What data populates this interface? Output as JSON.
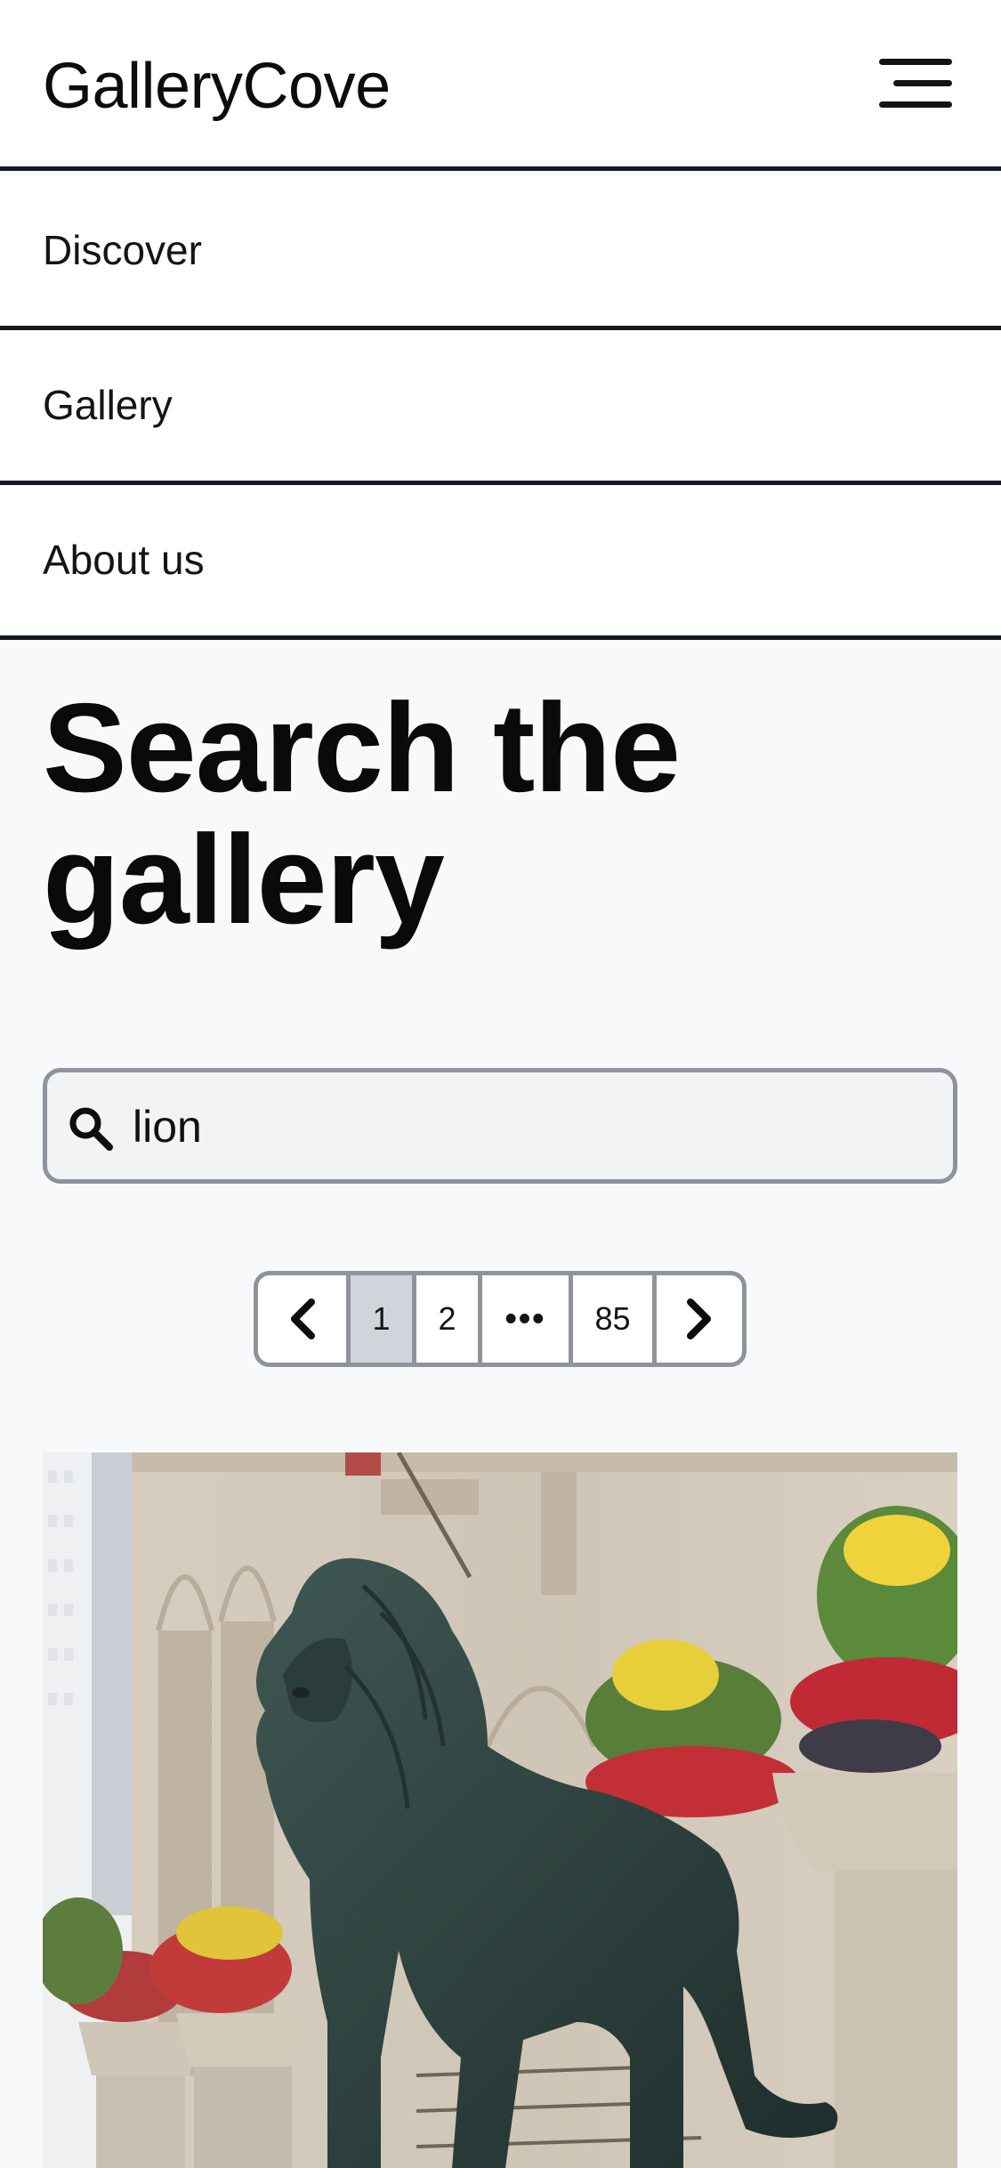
{
  "header": {
    "brand": "GalleryCove",
    "menu_icon": "hamburger-menu-icon"
  },
  "nav": {
    "items": [
      {
        "label": "Discover"
      },
      {
        "label": "Gallery"
      },
      {
        "label": "About us"
      }
    ]
  },
  "main": {
    "title": "Search the gallery",
    "search": {
      "value": "lion",
      "icon": "search-icon"
    },
    "pagination": {
      "prev_icon": "chevron-left-icon",
      "pages": [
        "1",
        "2",
        "•••",
        "85"
      ],
      "current": "1",
      "next_icon": "chevron-right-icon"
    },
    "results": [
      {
        "image": "bronze lion statue in front of museum building with flower planters"
      }
    ]
  },
  "colors": {
    "background": "#f8f9fb",
    "header_bg": "#ffffff",
    "divider": "#141a22",
    "input_border": "#8e939c",
    "current_page_bg": "#d0d4db"
  }
}
